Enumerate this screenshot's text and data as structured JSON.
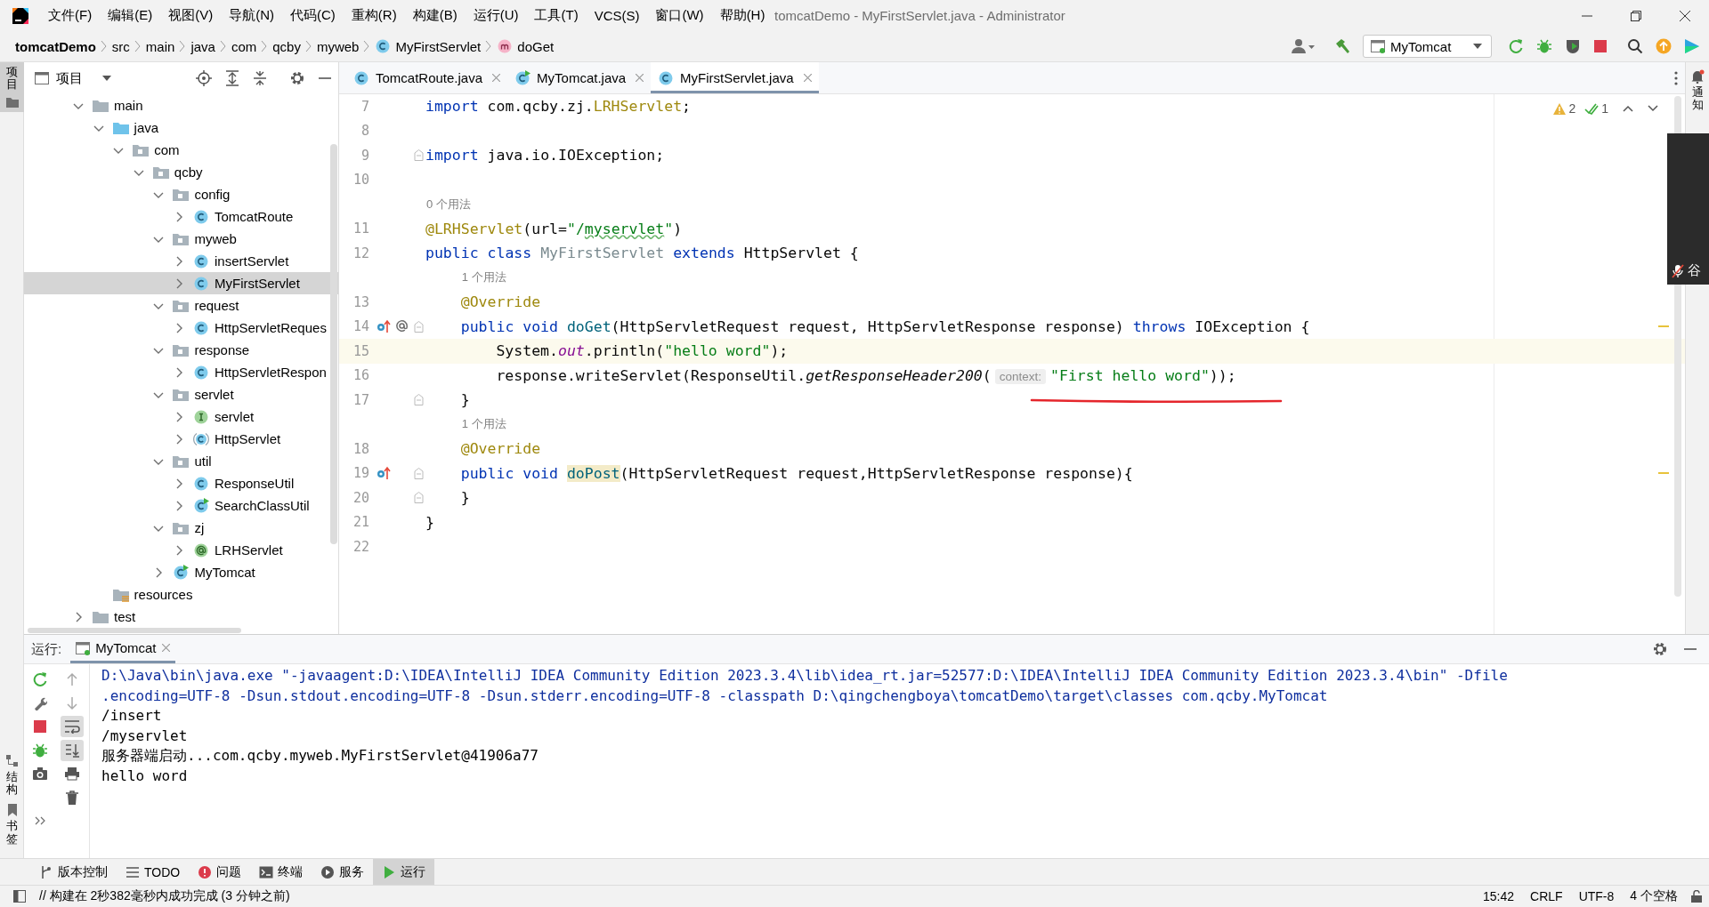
{
  "window": {
    "title": "tomcatDemo - MyFirstServlet.java - Administrator",
    "menu": [
      "文件(F)",
      "编辑(E)",
      "视图(V)",
      "导航(N)",
      "代码(C)",
      "重构(R)",
      "构建(B)",
      "运行(U)",
      "工具(T)",
      "VCS(S)",
      "窗口(W)",
      "帮助(H)"
    ]
  },
  "navbar": {
    "crumbs": [
      {
        "label": "tomcatDemo",
        "kind": "project"
      },
      {
        "label": "src",
        "kind": "dir"
      },
      {
        "label": "main",
        "kind": "dir"
      },
      {
        "label": "java",
        "kind": "dir"
      },
      {
        "label": "com",
        "kind": "dir"
      },
      {
        "label": "qcby",
        "kind": "dir"
      },
      {
        "label": "myweb",
        "kind": "dir"
      },
      {
        "label": "MyFirstServlet",
        "kind": "class"
      },
      {
        "label": "doGet",
        "kind": "method"
      }
    ],
    "run_config": "MyTomcat"
  },
  "left_stripe": [
    {
      "label": "项目",
      "kind": "project",
      "selected": true
    },
    {
      "label": "结构",
      "kind": "structure",
      "selected": false
    },
    {
      "label": "书签",
      "kind": "bookmarks",
      "selected": false
    }
  ],
  "right_stripe": [
    {
      "label": "通知",
      "kind": "notifications"
    }
  ],
  "project": {
    "title": "项目",
    "tree": [
      {
        "label": "main",
        "kind": "folder",
        "expanded": true,
        "selected": false,
        "children": [
          {
            "label": "java",
            "kind": "source-folder",
            "expanded": true,
            "selected": false,
            "children": [
              {
                "label": "com",
                "kind": "package",
                "expanded": true,
                "selected": false,
                "children": [
                  {
                    "label": "qcby",
                    "kind": "package",
                    "expanded": true,
                    "selected": false,
                    "children": [
                      {
                        "label": "config",
                        "kind": "package",
                        "expanded": true,
                        "selected": false,
                        "children": [
                          {
                            "label": "TomcatRoute",
                            "kind": "class",
                            "expanded": false,
                            "selected": false
                          }
                        ]
                      },
                      {
                        "label": "myweb",
                        "kind": "package",
                        "expanded": true,
                        "selected": false,
                        "children": [
                          {
                            "label": "insertServlet",
                            "kind": "class",
                            "expanded": false,
                            "selected": false
                          },
                          {
                            "label": "MyFirstServlet",
                            "kind": "class",
                            "expanded": false,
                            "selected": true
                          }
                        ]
                      },
                      {
                        "label": "request",
                        "kind": "package",
                        "expanded": true,
                        "selected": false,
                        "children": [
                          {
                            "label": "HttpServletReques",
                            "kind": "class",
                            "expanded": false,
                            "selected": false
                          }
                        ]
                      },
                      {
                        "label": "response",
                        "kind": "package",
                        "expanded": true,
                        "selected": false,
                        "children": [
                          {
                            "label": "HttpServletRespon",
                            "kind": "class",
                            "expanded": false,
                            "selected": false
                          }
                        ]
                      },
                      {
                        "label": "servlet",
                        "kind": "package",
                        "expanded": true,
                        "selected": false,
                        "children": [
                          {
                            "label": "servlet",
                            "kind": "interface",
                            "expanded": false,
                            "selected": false
                          },
                          {
                            "label": "HttpServlet",
                            "kind": "abstract",
                            "expanded": false,
                            "selected": false
                          }
                        ]
                      },
                      {
                        "label": "util",
                        "kind": "package",
                        "expanded": true,
                        "selected": false,
                        "children": [
                          {
                            "label": "ResponseUtil",
                            "kind": "class",
                            "expanded": false,
                            "selected": false
                          },
                          {
                            "label": "SearchClassUtil",
                            "kind": "main-class",
                            "expanded": false,
                            "selected": false
                          }
                        ]
                      },
                      {
                        "label": "zj",
                        "kind": "package",
                        "expanded": true,
                        "selected": false,
                        "children": [
                          {
                            "label": "LRHServlet",
                            "kind": "annotation",
                            "expanded": false,
                            "selected": false
                          }
                        ]
                      },
                      {
                        "label": "MyTomcat",
                        "kind": "main-class",
                        "expanded": false,
                        "selected": false
                      }
                    ]
                  }
                ]
              }
            ]
          },
          {
            "label": "resources",
            "kind": "resources-folder",
            "selected": false
          }
        ]
      },
      {
        "label": "test",
        "kind": "folder",
        "expanded": false,
        "selected": false
      }
    ]
  },
  "editor": {
    "tabs": [
      {
        "label": "TomcatRoute.java",
        "kind": "class",
        "selected": false
      },
      {
        "label": "MyTomcat.java",
        "kind": "main-class",
        "selected": false
      },
      {
        "label": "MyFirstServlet.java",
        "kind": "class",
        "selected": true
      }
    ],
    "warnings": "2",
    "passed": "1",
    "pen_mark": {
      "kind": "underline"
    },
    "lines": [
      {
        "kind": "code",
        "number": "7",
        "current": false,
        "fold": false,
        "warning": false,
        "tokens": [
          {
            "text": "import",
            "kind": "kw"
          },
          {
            "text": " com.qcby.zj.",
            "kind": "plain"
          },
          {
            "text": "LRHServlet",
            "kind": "ann"
          },
          {
            "text": ";",
            "kind": "plain"
          }
        ]
      },
      {
        "kind": "code",
        "number": "8",
        "current": false,
        "fold": false,
        "warning": false
      },
      {
        "kind": "code",
        "number": "9",
        "current": false,
        "fold": true,
        "warning": false,
        "tokens": [
          {
            "text": "import",
            "kind": "kw"
          },
          {
            "text": " java.io.IOException;",
            "kind": "plain"
          }
        ]
      },
      {
        "kind": "code",
        "number": "10",
        "current": false,
        "fold": false,
        "warning": false
      },
      {
        "kind": "usage",
        "text": "0 个用法"
      },
      {
        "kind": "code",
        "number": "11",
        "current": false,
        "fold": false,
        "warning": false,
        "tokens": [
          {
            "text": "@LRHServlet",
            "kind": "ann"
          },
          {
            "text": "(url=",
            "kind": "plain"
          },
          {
            "text": "\"/",
            "kind": "str"
          },
          {
            "text": "myservlet",
            "kind": "typo"
          },
          {
            "text": "\"",
            "kind": "str"
          },
          {
            "text": ")",
            "kind": "plain"
          }
        ]
      },
      {
        "kind": "code",
        "number": "12",
        "current": false,
        "fold": false,
        "warning": false,
        "tokens": [
          {
            "text": "public class ",
            "kind": "kw"
          },
          {
            "text": "MyFirstServlet",
            "kind": "unused"
          },
          {
            "text": " extends",
            "kind": "kw"
          },
          {
            "text": " HttpServlet {",
            "kind": "plain"
          }
        ]
      },
      {
        "kind": "usage",
        "text": "1 个用法"
      },
      {
        "kind": "code",
        "number": "13",
        "current": false,
        "fold": false,
        "warning": false,
        "tokens": [
          {
            "text": "    @Override",
            "kind": "ann"
          }
        ]
      },
      {
        "kind": "code",
        "number": "14",
        "current": false,
        "fold": true,
        "warning": true,
        "gutter": [
          {
            "kind": "override"
          },
          {
            "kind": "annotation"
          }
        ],
        "tokens": [
          {
            "text": "    public void ",
            "kind": "kw"
          },
          {
            "text": "doGet",
            "kind": "decl"
          },
          {
            "text": "(HttpServletRequest request, HttpServletResponse response) ",
            "kind": "plain"
          },
          {
            "text": "throws",
            "kind": "kw"
          },
          {
            "text": " IOException {",
            "kind": "plain"
          }
        ]
      },
      {
        "kind": "code",
        "number": "15",
        "current": true,
        "fold": false,
        "warning": false,
        "tokens": [
          {
            "text": "        System.",
            "kind": "plain"
          },
          {
            "text": "out",
            "kind": "static"
          },
          {
            "text": ".println(",
            "kind": "plain"
          },
          {
            "text": "\"hello word\"",
            "kind": "str"
          },
          {
            "text": ");",
            "kind": "plain"
          }
        ]
      },
      {
        "kind": "code",
        "number": "16",
        "current": false,
        "fold": false,
        "warning": false,
        "tokens": [
          {
            "text": "        response.writeServlet(ResponseUtil.",
            "kind": "plain"
          },
          {
            "text": "getResponseHeader200",
            "kind": "italic"
          },
          {
            "text": "(",
            "kind": "plain"
          },
          {
            "text": "context:",
            "kind": "inlay"
          },
          {
            "text": "\"First hello word\"",
            "kind": "str"
          },
          {
            "text": "));",
            "kind": "plain"
          }
        ]
      },
      {
        "kind": "code",
        "number": "17",
        "current": false,
        "fold": true,
        "warning": false,
        "tokens": [
          {
            "text": "    }",
            "kind": "plain"
          }
        ]
      },
      {
        "kind": "usage",
        "text": "1 个用法"
      },
      {
        "kind": "code",
        "number": "18",
        "current": false,
        "fold": false,
        "warning": false,
        "tokens": [
          {
            "text": "    @Override",
            "kind": "ann"
          }
        ]
      },
      {
        "kind": "code",
        "number": "19",
        "current": false,
        "fold": true,
        "warning": true,
        "gutter": [
          {
            "kind": "override"
          }
        ],
        "tokens": [
          {
            "text": "    public void ",
            "kind": "kw"
          },
          {
            "text": "doPost",
            "kind": "highlight"
          },
          {
            "text": "(HttpServletRequest request,HttpServletResponse response){",
            "kind": "plain"
          }
        ]
      },
      {
        "kind": "code",
        "number": "20",
        "current": false,
        "fold": true,
        "warning": false,
        "tokens": [
          {
            "text": "    }",
            "kind": "plain"
          }
        ]
      },
      {
        "kind": "code",
        "number": "21",
        "current": false,
        "fold": false,
        "warning": false,
        "tokens": [
          {
            "text": "}",
            "kind": "plain"
          }
        ]
      },
      {
        "kind": "code",
        "number": "22",
        "current": false,
        "fold": false,
        "warning": false
      }
    ]
  },
  "overlay": {
    "text": "谷"
  },
  "run": {
    "label": "运行:",
    "tab": "MyTomcat",
    "soft_wrap": true,
    "scroll_to_end": true,
    "console": [
      {
        "text": "D:\\Java\\bin\\java.exe \"-javaagent:D:\\IDEA\\IntelliJ IDEA Community Edition 2023.3.4\\lib\\idea_rt.jar=52577:D:\\IDEA\\IntelliJ IDEA Community Edition 2023.3.4\\bin\" -Dfile",
        "kind": "command"
      },
      {
        "text": ".encoding=UTF-8 -Dsun.stdout.encoding=UTF-8 -Dsun.stderr.encoding=UTF-8 -classpath D:\\qingchengboya\\tomcatDemo\\target\\classes com.qcby.MyTomcat",
        "kind": "command"
      },
      {
        "text": "/insert",
        "kind": "output"
      },
      {
        "text": "/myservlet",
        "kind": "output"
      },
      {
        "text": "服务器端启动...com.qcby.myweb.MyFirstServlet@41906a77",
        "kind": "output"
      },
      {
        "text": "hello word",
        "kind": "output"
      }
    ]
  },
  "tool_windows": [
    {
      "label": "版本控制",
      "kind": "vcs",
      "selected": false
    },
    {
      "label": "TODO",
      "kind": "todo",
      "selected": false
    },
    {
      "label": "问题",
      "kind": "problems",
      "selected": false
    },
    {
      "label": "终端",
      "kind": "terminal",
      "selected": false
    },
    {
      "label": "服务",
      "kind": "services",
      "selected": false
    },
    {
      "label": "运行",
      "kind": "run",
      "selected": true
    }
  ],
  "status_bar": {
    "message": "// 构建在 2秒382毫秒内成功完成 (3 分钟之前)",
    "items": [
      "15:42",
      "CRLF",
      "UTF-8",
      "4 个空格"
    ]
  }
}
